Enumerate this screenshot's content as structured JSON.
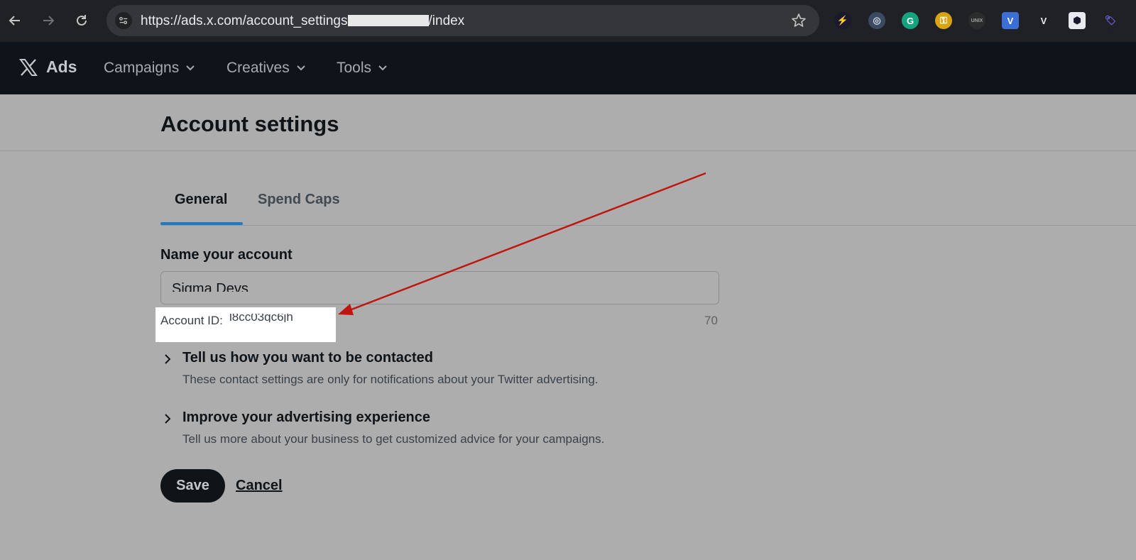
{
  "browser": {
    "url_prefix": "https://ads.x.com/account_settings",
    "url_suffix": "/index",
    "extensions": [
      {
        "name": "bolt-extension-icon",
        "bg": "#1a1a2e",
        "glyph": "⚡",
        "color": "#f5c542"
      },
      {
        "name": "circle-extension-icon",
        "bg": "#3b4a63",
        "glyph": "◎",
        "color": "#cfd8e3"
      },
      {
        "name": "grammarly-extension-icon",
        "bg": "#15a37f",
        "glyph": "G",
        "color": "#ffffff"
      },
      {
        "name": "key-extension-icon",
        "bg": "#d9a414",
        "glyph": "⚿",
        "color": "#ffffff"
      },
      {
        "name": "unix-extension-icon",
        "bg": "#2c2c2c",
        "glyph": "UNIX",
        "color": "#9aa0a6"
      },
      {
        "name": "v-blue-extension-icon",
        "bg": "#3c6fd6",
        "glyph": "V",
        "color": "#ffffff"
      },
      {
        "name": "v-dark-extension-icon",
        "bg": "#202124",
        "glyph": "V",
        "color": "#e8eaed"
      },
      {
        "name": "hex-extension-icon",
        "bg": "#e8eaed",
        "glyph": "⬢",
        "color": "#1a1a2e"
      },
      {
        "name": "tag-extension-icon",
        "bg": "#202124",
        "glyph": "🏷",
        "color": "#6b63e6"
      }
    ]
  },
  "header": {
    "brand": "Ads",
    "menus": [
      {
        "label": "Campaigns"
      },
      {
        "label": "Creatives"
      },
      {
        "label": "Tools"
      }
    ]
  },
  "page": {
    "title": "Account settings",
    "tabs": [
      {
        "label": "General",
        "active": true
      },
      {
        "label": "Spend Caps",
        "active": false
      }
    ],
    "name_field": {
      "label": "Name your account",
      "value": "Sigma Devs",
      "char_count": "70"
    },
    "account_id": {
      "label": "Account ID:",
      "value": "l8cc03qc6jh"
    },
    "sections": [
      {
        "title": "Tell us how you want to be contacted",
        "description": "These contact settings are only for notifications about your Twitter advertising."
      },
      {
        "title": "Improve your advertising experience",
        "description": "Tell us more about your business to get customized advice for your campaigns."
      }
    ],
    "save_label": "Save",
    "cancel_label": "Cancel"
  },
  "colors": {
    "accent": "#1d7bc4",
    "annotation_arrow": "#c0140c"
  }
}
